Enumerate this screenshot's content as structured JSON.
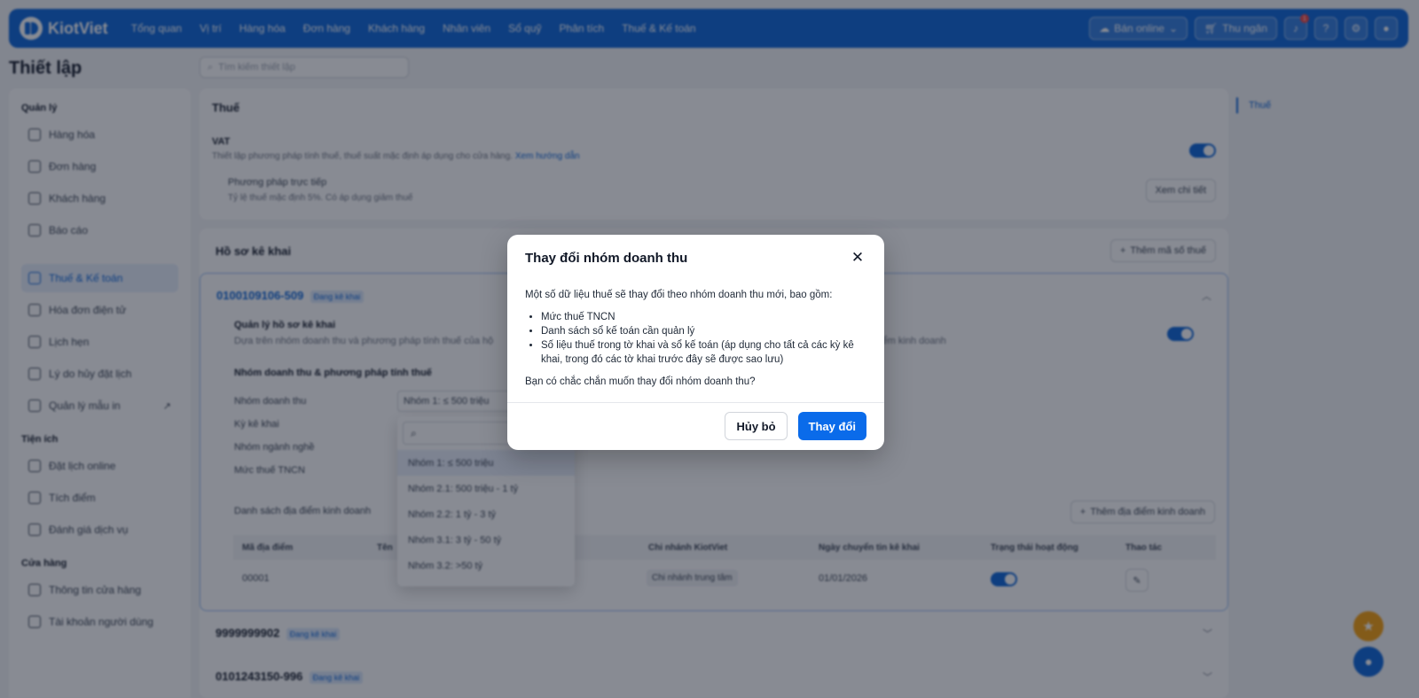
{
  "app": {
    "logo_text": "KiotViet"
  },
  "nav": {
    "items": [
      "Tổng quan",
      "Vị trí",
      "Hàng hóa",
      "Đơn hàng",
      "Khách hàng",
      "Nhân viên",
      "Sổ quỹ",
      "Phân tích",
      "Thuế & Kế toán"
    ],
    "sell_online": "Bán online",
    "cashier": "Thu ngân",
    "notification_count": "1"
  },
  "page": {
    "title": "Thiết lập",
    "search_placeholder": "Tìm kiếm thiết lập"
  },
  "sidebar": {
    "sections": [
      {
        "title": "Quản lý",
        "items": [
          "Hàng hóa",
          "Đơn hàng",
          "Khách hàng",
          "Báo cáo"
        ]
      },
      {
        "title": "",
        "items": [
          "Thuế & Kế toán",
          "Hóa đơn điện tử",
          "Lịch hẹn",
          "Lý do hủy đặt lịch",
          "Quản lý mẫu in"
        ]
      },
      {
        "title": "Tiện ích",
        "items": [
          "Đặt lịch online",
          "Tích điểm",
          "Đánh giá dịch vụ"
        ]
      },
      {
        "title": "Cửa hàng",
        "items": [
          "Thông tin cửa hàng",
          "Tài khoản người dùng"
        ]
      }
    ],
    "active": "Thuế & Kế toán"
  },
  "tax": {
    "title": "Thuế",
    "vat_title": "VAT",
    "vat_desc": "Thiết lập phương pháp tính thuế, thuế suất mặc định áp dụng cho cửa hàng.",
    "vat_link": "Xem hướng dẫn",
    "method_title": "Phương pháp trực tiếp",
    "method_desc": "Tỷ lệ thuế mặc định 5%. Có áp dụng giảm thuế",
    "view_detail": "Xem chi tiết"
  },
  "profile": {
    "title": "Hồ sơ kê khai",
    "add_tax_code": "Thêm mã số thuế",
    "badge": "Đang kê khai",
    "codes": [
      "0100109106-509",
      "9999999902",
      "0101243150-996"
    ],
    "manage_title": "Quản lý hồ sơ kê khai",
    "manage_desc": "Dựa trên nhóm doanh thu và phương pháp tính thuế của hộ",
    "manage_desc_tail": "điểm kinh doanh",
    "group_section": "Nhóm doanh thu & phương pháp tính thuế",
    "labels": [
      "Nhóm doanh thu",
      "Kỳ kê khai",
      "Nhóm ngành nghề",
      "Mức thuế TNCN"
    ],
    "group_value": "Nhóm 1: ≤ 500 triệu",
    "locations_title": "Danh sách địa điểm kinh doanh",
    "add_location": "Thêm địa điểm kinh doanh",
    "table_headers": [
      "Mã địa điểm",
      "Tên",
      "Chi nhánh KiotViet",
      "Ngày chuyển tin kê khai",
      "Trạng thái hoạt động",
      "Thao tác"
    ],
    "row": {
      "code": "00001",
      "branch": "Chi nhánh trung tâm",
      "date": "01/01/2026"
    }
  },
  "dropdown": {
    "options": [
      "Nhóm 1: ≤ 500 triệu",
      "Nhóm 2.1: 500 triệu - 1 tỷ",
      "Nhóm 2.2: 1 tỷ - 3 tỷ",
      "Nhóm 3.1: 3 tỷ - 50 tỷ",
      "Nhóm 3.2: >50 tỷ"
    ],
    "selected": 0
  },
  "right_panel": {
    "item": "Thuế"
  },
  "modal": {
    "title": "Thay đổi nhóm doanh thu",
    "intro": "Một số dữ liệu thuế sẽ thay đổi theo nhóm doanh thu mới, bao gồm:",
    "bullets": [
      "Mức thuế TNCN",
      "Danh sách sổ kế toán cần quản lý",
      "Số liệu thuế trong tờ khai và sổ kế toán (áp dụng cho tất cả các kỳ kê khai, trong đó các tờ khai trước đây sẽ được sao lưu)"
    ],
    "question": "Bạn có chắc chắn muốn thay đổi nhóm doanh thu?",
    "cancel_label": "Hủy bỏ",
    "confirm_label": "Thay đổi"
  },
  "colors": {
    "brand": "#0a64d8",
    "primary_button": "#0a6bea",
    "fab_star": "#f59e0b",
    "fab_support": "#0a64d8"
  }
}
